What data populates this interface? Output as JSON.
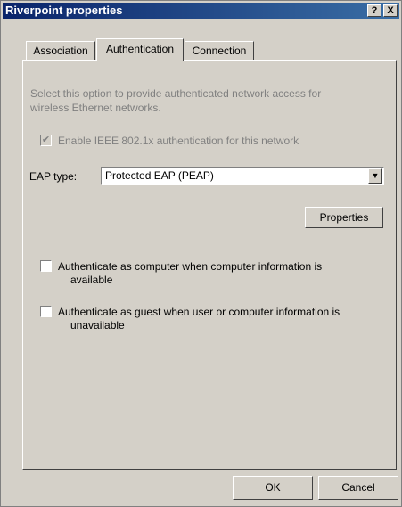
{
  "window": {
    "title": "Riverpoint properties",
    "help_glyph": "?",
    "close_glyph": "X"
  },
  "tabs": [
    {
      "label": "Association",
      "active": false
    },
    {
      "label": "Authentication",
      "active": true
    },
    {
      "label": "Connection",
      "active": false
    }
  ],
  "auth": {
    "description_line1": "Select this option to provide authenticated network access for",
    "description_line2": "wireless Ethernet networks.",
    "enable_8021x": {
      "label": "Enable IEEE 802.1x authentication for this network",
      "checked": true,
      "enabled": false
    },
    "eap_type_label": "EAP type:",
    "eap_type_value": "Protected EAP (PEAP)",
    "properties_label": "Properties",
    "auth_computer": {
      "line1": "Authenticate as computer when computer information is",
      "line2": "available",
      "checked": false
    },
    "auth_guest": {
      "line1": "Authenticate as guest when user or computer information is",
      "line2": "unavailable",
      "checked": false
    }
  },
  "footer": {
    "ok_label": "OK",
    "cancel_label": "Cancel"
  }
}
